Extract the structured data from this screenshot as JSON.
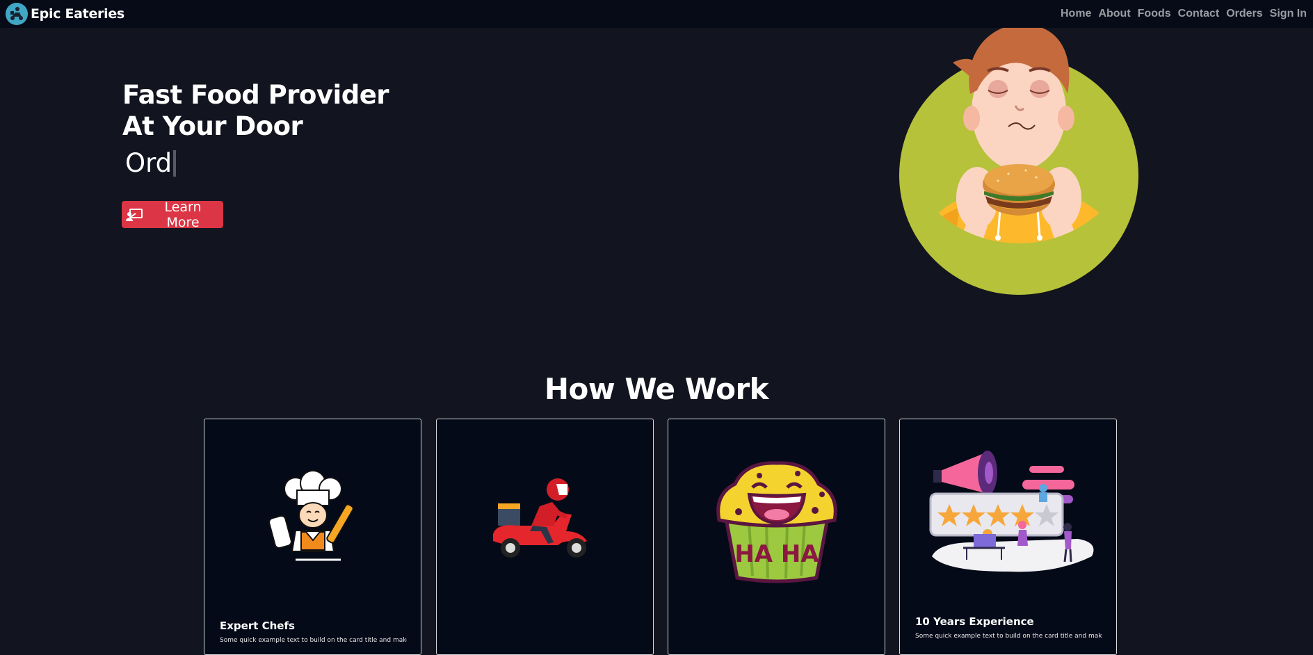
{
  "navbar": {
    "brand": "Epic Eateries",
    "links": [
      "Home",
      "About",
      "Foods",
      "Contact",
      "Orders",
      "Sign In"
    ]
  },
  "hero": {
    "title_line1": "Fast Food Provider",
    "title_line2": "At Your Door",
    "typed_text": "Ord",
    "button_label": "Learn More"
  },
  "how_we_work": {
    "title": "How We Work",
    "cards": [
      {
        "title": "Expert Chefs",
        "text": "Some quick example text to build on the card title and make up the bulk of the card's content."
      },
      {
        "title": "",
        "text": ""
      },
      {
        "title": "",
        "text": ""
      },
      {
        "title": "10 Years Experience",
        "text": "Some quick example text to build on the card title and make up the bulk of the card's content."
      }
    ]
  },
  "colors": {
    "background": "#12151f",
    "navbar": "#070b17",
    "accent_button": "#dc3545",
    "card_background": "#050a18"
  },
  "icons": [
    "delivery-scooter-logo-icon",
    "presentation-icon"
  ]
}
